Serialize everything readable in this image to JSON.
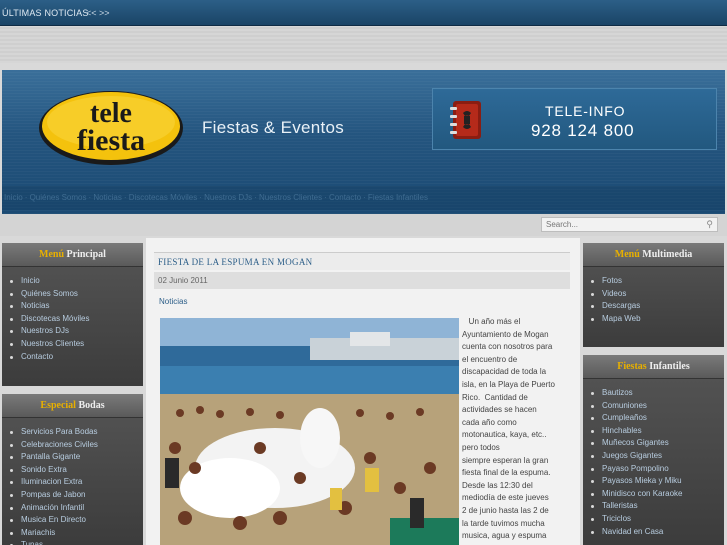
{
  "ticker": {
    "label": "ÚLTIMAS NOTICIAS",
    "arrows": "<< >>"
  },
  "header": {
    "logo_line1": "tele",
    "logo_line2": "fiesta",
    "slogan": "Fiestas & Eventos",
    "teleinfo_title": "TELE-INFO",
    "teleinfo_number": "928 124 800",
    "nav_items": [
      "Inicio",
      "Quiénes Somos",
      "Noticias",
      "Discotecas Móviles",
      "Nuestros DJs",
      "Nuestros Clientes",
      "Contacto",
      "Fiestas Infantiles"
    ]
  },
  "search": {
    "placeholder": "Search..."
  },
  "left_modules": [
    {
      "title_accent": "Menú",
      "title_rest": "Principal",
      "items": [
        "Inicio",
        "Quiénes Somos",
        "Noticias",
        "Discotecas Móviles",
        "Nuestros DJs",
        "Nuestros Clientes",
        "Contacto"
      ]
    },
    {
      "title_accent": "Especial",
      "title_rest": "Bodas",
      "items": [
        "Servicios Para Bodas",
        "Celebraciones Civiles",
        "Pantalla Gigante",
        "Sonido Extra",
        "Iluminacion Extra",
        "Pompas de Jabon",
        "Animación Infantil",
        "Musica En Directo",
        "Mariachis",
        "Tunas"
      ]
    }
  ],
  "right_modules": [
    {
      "title_accent": "Menú",
      "title_rest": "Multimedia",
      "items": [
        "Fotos",
        "Videos",
        "Descargas",
        "Mapa Web"
      ]
    },
    {
      "title_accent": "Fiestas",
      "title_rest": "Infantiles",
      "items": [
        "Bautizos",
        "Comuniones",
        "Cumpleaños",
        "Hinchables",
        "Muñecos Gigantes",
        "Juegos Gigantes",
        "Payaso Pompolino",
        "Payasos Mieka y Miku",
        "Minidisco con Karaoke",
        "Talleristas",
        "Triciclos",
        "Navidad en Casa"
      ]
    }
  ],
  "article": {
    "title": "FIESTA DE LA ESPUMA EN MOGAN",
    "date": "02 Junio 2011",
    "category": "Noticias",
    "lines": [
      "   Un año más el",
      "Ayuntamiento de Mogan",
      "cuenta con nosotros para",
      "el encuentro de",
      "discapacidad de toda la",
      "isla, en la Playa de Puerto",
      "Rico.  Cantidad de",
      "actividades se hacen",
      "cada año como",
      "motonautica, kaya, etc..",
      "pero todos",
      "siempre esperan la gran",
      "fiesta final de la espuma.",
      "Desde las 12:30 del",
      "mediodía de este jueves",
      "2 de junio hasta las 2 de",
      "la tarde tuvimos mucha",
      "musica, agua y espuma"
    ]
  }
}
